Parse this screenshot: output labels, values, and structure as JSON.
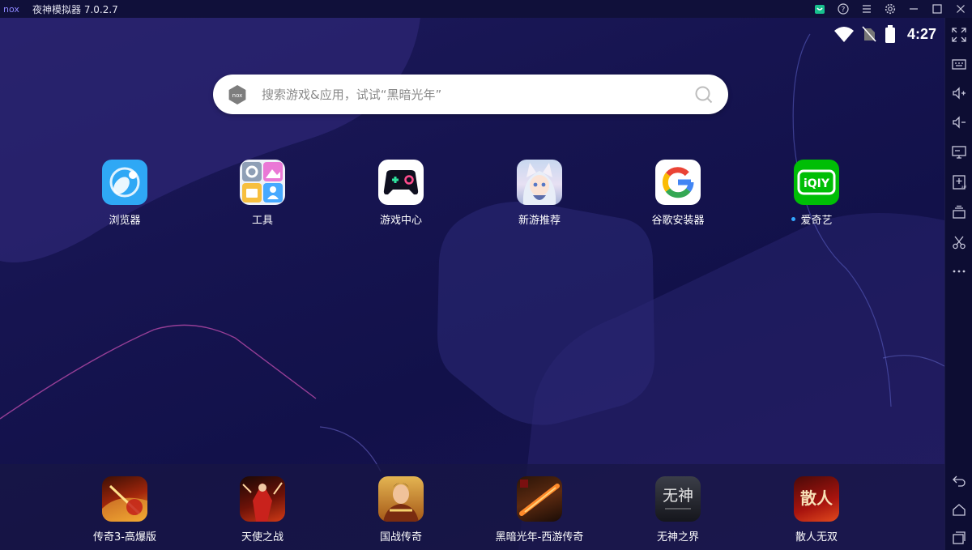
{
  "window": {
    "logo_text": "nox",
    "title": "夜神模拟器 7.0.2.7",
    "controls": [
      "store-icon",
      "help-icon",
      "menu-icon",
      "settings-icon",
      "minimize-icon",
      "maximize-icon",
      "close-icon"
    ]
  },
  "status": {
    "time": "4:27"
  },
  "search": {
    "placeholder": "搜索游戏&应用，试试“黑暗光年”"
  },
  "apps": [
    {
      "label": "浏览器",
      "icon": "browser-icon"
    },
    {
      "label": "工具",
      "icon": "tools-icon"
    },
    {
      "label": "游戏中心",
      "icon": "game-center-icon"
    },
    {
      "label": "新游推荐",
      "icon": "new-games-icon"
    },
    {
      "label": "谷歌安装器",
      "icon": "google-installer-icon"
    },
    {
      "label": "爱奇艺",
      "icon": "iqiyi-icon",
      "icon_text": "iQIY"
    }
  ],
  "dock": [
    {
      "label": "传奇3-高爆版",
      "icon": "legend3-game-icon"
    },
    {
      "label": "天使之战",
      "icon": "angel-war-game-icon"
    },
    {
      "label": "国战传奇",
      "icon": "guozhan-legend-game-icon"
    },
    {
      "label": "黑暗光年-西游传奇",
      "icon": "dark-lightyear-game-icon"
    },
    {
      "label": "无神之界",
      "icon": "wushen-game-icon",
      "icon_text": "无神"
    },
    {
      "label": "散人无双",
      "icon": "sanren-game-icon",
      "icon_text": "散人"
    }
  ],
  "sidebar": [
    "fullscreen-icon",
    "keyboard-icon",
    "volume-up-icon",
    "volume-down-icon",
    "screen-icon",
    "apk-install-icon",
    "multi-instance-icon",
    "scissors-icon",
    "more-icon",
    "back-icon",
    "home-icon",
    "recent-apps-icon"
  ],
  "colors": {
    "titlebar": "#10103a",
    "screen_bg": "#161450",
    "iqiyi_green": "#00be06",
    "browser_blue": "#2fa8f5",
    "new_dot": "#33a7ff"
  }
}
